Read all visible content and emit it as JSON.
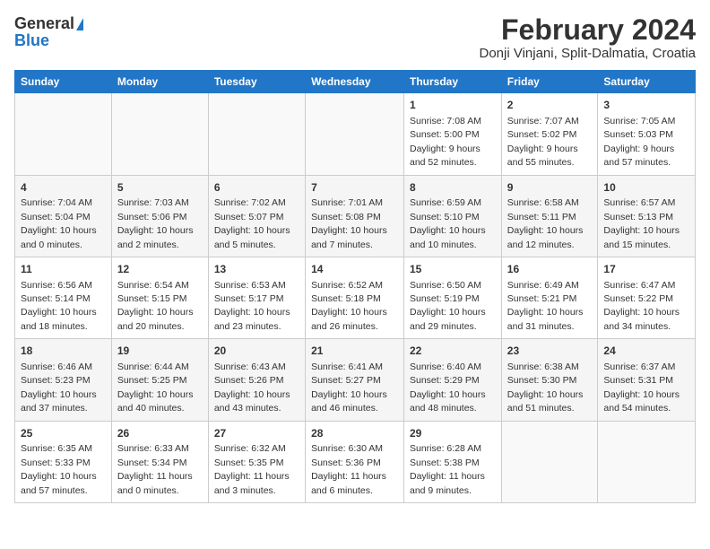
{
  "header": {
    "logo_general": "General",
    "logo_blue": "Blue",
    "title": "February 2024",
    "subtitle": "Donji Vinjani, Split-Dalmatia, Croatia"
  },
  "days_of_week": [
    "Sunday",
    "Monday",
    "Tuesday",
    "Wednesday",
    "Thursday",
    "Friday",
    "Saturday"
  ],
  "weeks": [
    [
      {
        "day": "",
        "info": ""
      },
      {
        "day": "",
        "info": ""
      },
      {
        "day": "",
        "info": ""
      },
      {
        "day": "",
        "info": ""
      },
      {
        "day": "1",
        "info": "Sunrise: 7:08 AM\nSunset: 5:00 PM\nDaylight: 9 hours\nand 52 minutes."
      },
      {
        "day": "2",
        "info": "Sunrise: 7:07 AM\nSunset: 5:02 PM\nDaylight: 9 hours\nand 55 minutes."
      },
      {
        "day": "3",
        "info": "Sunrise: 7:05 AM\nSunset: 5:03 PM\nDaylight: 9 hours\nand 57 minutes."
      }
    ],
    [
      {
        "day": "4",
        "info": "Sunrise: 7:04 AM\nSunset: 5:04 PM\nDaylight: 10 hours\nand 0 minutes."
      },
      {
        "day": "5",
        "info": "Sunrise: 7:03 AM\nSunset: 5:06 PM\nDaylight: 10 hours\nand 2 minutes."
      },
      {
        "day": "6",
        "info": "Sunrise: 7:02 AM\nSunset: 5:07 PM\nDaylight: 10 hours\nand 5 minutes."
      },
      {
        "day": "7",
        "info": "Sunrise: 7:01 AM\nSunset: 5:08 PM\nDaylight: 10 hours\nand 7 minutes."
      },
      {
        "day": "8",
        "info": "Sunrise: 6:59 AM\nSunset: 5:10 PM\nDaylight: 10 hours\nand 10 minutes."
      },
      {
        "day": "9",
        "info": "Sunrise: 6:58 AM\nSunset: 5:11 PM\nDaylight: 10 hours\nand 12 minutes."
      },
      {
        "day": "10",
        "info": "Sunrise: 6:57 AM\nSunset: 5:13 PM\nDaylight: 10 hours\nand 15 minutes."
      }
    ],
    [
      {
        "day": "11",
        "info": "Sunrise: 6:56 AM\nSunset: 5:14 PM\nDaylight: 10 hours\nand 18 minutes."
      },
      {
        "day": "12",
        "info": "Sunrise: 6:54 AM\nSunset: 5:15 PM\nDaylight: 10 hours\nand 20 minutes."
      },
      {
        "day": "13",
        "info": "Sunrise: 6:53 AM\nSunset: 5:17 PM\nDaylight: 10 hours\nand 23 minutes."
      },
      {
        "day": "14",
        "info": "Sunrise: 6:52 AM\nSunset: 5:18 PM\nDaylight: 10 hours\nand 26 minutes."
      },
      {
        "day": "15",
        "info": "Sunrise: 6:50 AM\nSunset: 5:19 PM\nDaylight: 10 hours\nand 29 minutes."
      },
      {
        "day": "16",
        "info": "Sunrise: 6:49 AM\nSunset: 5:21 PM\nDaylight: 10 hours\nand 31 minutes."
      },
      {
        "day": "17",
        "info": "Sunrise: 6:47 AM\nSunset: 5:22 PM\nDaylight: 10 hours\nand 34 minutes."
      }
    ],
    [
      {
        "day": "18",
        "info": "Sunrise: 6:46 AM\nSunset: 5:23 PM\nDaylight: 10 hours\nand 37 minutes."
      },
      {
        "day": "19",
        "info": "Sunrise: 6:44 AM\nSunset: 5:25 PM\nDaylight: 10 hours\nand 40 minutes."
      },
      {
        "day": "20",
        "info": "Sunrise: 6:43 AM\nSunset: 5:26 PM\nDaylight: 10 hours\nand 43 minutes."
      },
      {
        "day": "21",
        "info": "Sunrise: 6:41 AM\nSunset: 5:27 PM\nDaylight: 10 hours\nand 46 minutes."
      },
      {
        "day": "22",
        "info": "Sunrise: 6:40 AM\nSunset: 5:29 PM\nDaylight: 10 hours\nand 48 minutes."
      },
      {
        "day": "23",
        "info": "Sunrise: 6:38 AM\nSunset: 5:30 PM\nDaylight: 10 hours\nand 51 minutes."
      },
      {
        "day": "24",
        "info": "Sunrise: 6:37 AM\nSunset: 5:31 PM\nDaylight: 10 hours\nand 54 minutes."
      }
    ],
    [
      {
        "day": "25",
        "info": "Sunrise: 6:35 AM\nSunset: 5:33 PM\nDaylight: 10 hours\nand 57 minutes."
      },
      {
        "day": "26",
        "info": "Sunrise: 6:33 AM\nSunset: 5:34 PM\nDaylight: 11 hours\nand 0 minutes."
      },
      {
        "day": "27",
        "info": "Sunrise: 6:32 AM\nSunset: 5:35 PM\nDaylight: 11 hours\nand 3 minutes."
      },
      {
        "day": "28",
        "info": "Sunrise: 6:30 AM\nSunset: 5:36 PM\nDaylight: 11 hours\nand 6 minutes."
      },
      {
        "day": "29",
        "info": "Sunrise: 6:28 AM\nSunset: 5:38 PM\nDaylight: 11 hours\nand 9 minutes."
      },
      {
        "day": "",
        "info": ""
      },
      {
        "day": "",
        "info": ""
      }
    ]
  ]
}
